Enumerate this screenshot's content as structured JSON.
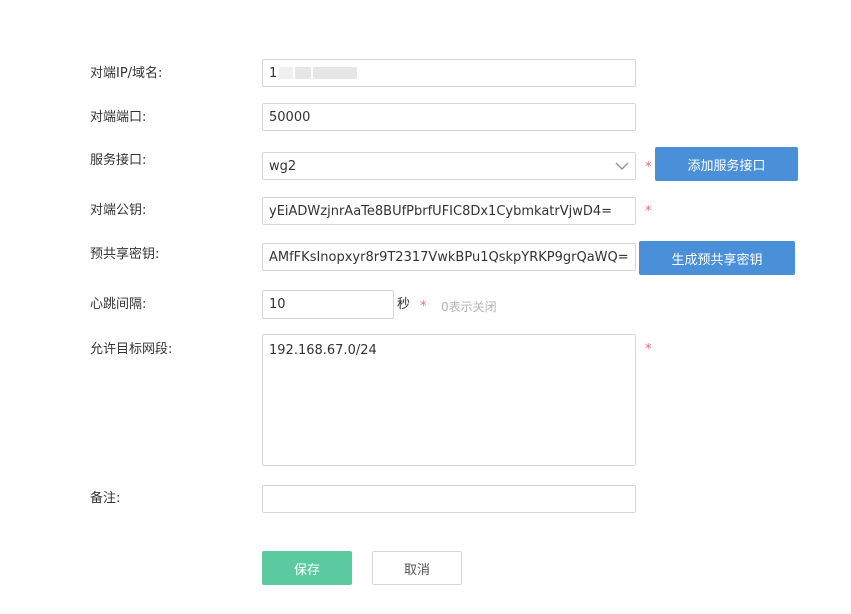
{
  "form": {
    "peer_host": {
      "label": "对端IP/域名:",
      "value": "1"
    },
    "peer_port": {
      "label": "对端端口:",
      "value": "50000"
    },
    "service_interface": {
      "label": "服务接口:",
      "value": "wg2",
      "add_button": "添加服务接口"
    },
    "peer_public_key": {
      "label": "对端公钥:",
      "value": "yEiADWzjnrAaTe8BUfPbrfUFIC8Dx1CybmkatrVjwD4="
    },
    "preshared_key": {
      "label": "预共享密钥:",
      "value": "AMfFKsInopxyr8r9T2317VwkBPu1QskpYRKP9grQaWQ=",
      "generate_button": "生成预共享密钥"
    },
    "heartbeat": {
      "label": "心跳间隔:",
      "value": "10",
      "unit": "秒",
      "hint": "0表示关闭"
    },
    "allowed_subnets": {
      "label": "允许目标网段:",
      "value": "192.168.67.0/24"
    },
    "remark": {
      "label": "备注:",
      "value": ""
    },
    "required_mark": "*"
  },
  "actions": {
    "save": "保存",
    "cancel": "取消"
  },
  "colors": {
    "primary_blue": "#4a90d9",
    "save_green": "#5ccaa0",
    "required_red": "#f56c6c"
  }
}
